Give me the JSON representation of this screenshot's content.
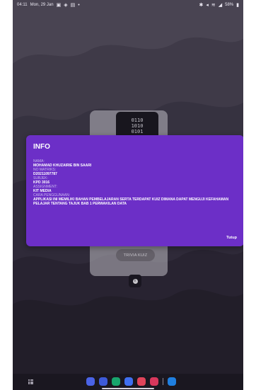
{
  "status_bar": {
    "time": "04:11",
    "date": "Mon, 29 Jan",
    "battery": "58%"
  },
  "app": {
    "logo_text": [
      "0110",
      "1010",
      "0101"
    ],
    "trivia_button_label": "TRIVIA KUIZ"
  },
  "dialog": {
    "title": "INFO",
    "fields": [
      {
        "label": "NAMA:",
        "value": "MOHAMAD KHUZAIRIE BIN SAARI"
      },
      {
        "label": "NO MATRIKS:",
        "value": "D20211097787"
      },
      {
        "label": "SUBJEK:",
        "value": "KPD 3016"
      },
      {
        "label": "ASSIGNMENT:",
        "value": "KIT MEDIA"
      },
      {
        "label": "CARA PENGGUNAAN:",
        "value": "APPLIKASI INI MEMILIKI BAHAN PEMBELAJARAN SERTA TERDAPAT KUIZ DIMANA DAPAT MENGUJI KEFAHAMAN PELAJAR TENTANG TAJUK BAB 1 PERWAKILAN DATA"
      }
    ],
    "close_label": "Tutup"
  },
  "dock": {
    "apps": [
      {
        "icon": "browser-app-icon",
        "color": "#4a63e6"
      },
      {
        "icon": "messages-app-icon",
        "color": "#3d5ad9"
      },
      {
        "icon": "phone-app-icon",
        "color": "#18a56d"
      },
      {
        "icon": "chat-app-icon",
        "color": "#3f6ff0"
      },
      {
        "icon": "camera-app-icon",
        "color": "#e0445a"
      },
      {
        "icon": "gallery-app-icon",
        "color": "#d8375c"
      },
      {
        "icon": "recent-app-icon",
        "color": "#1f7fe0"
      }
    ]
  },
  "colors": {
    "dialog_background": "#6c2fc7",
    "screen_background": "#2a2436"
  }
}
